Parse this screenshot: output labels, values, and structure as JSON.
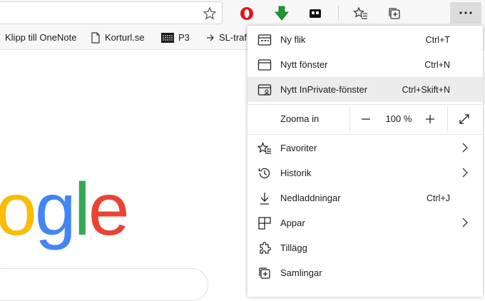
{
  "toolbar": {
    "icons": [
      "favorite-star-icon",
      "opera-icon",
      "download-arrow-icon",
      "extension-icon",
      "favorites-list-icon",
      "collections-icon",
      "more-icon"
    ],
    "colors": {
      "opera_red": "#e0161d",
      "download_green": "#1a9a2c"
    }
  },
  "bookmarks": {
    "items": [
      {
        "label": "Klipp till OneNote",
        "icon": "none"
      },
      {
        "label": "Korturl.se",
        "icon": "page-icon"
      },
      {
        "label": "P3",
        "icon": "sr-logo-icon"
      },
      {
        "label": "SL-traf",
        "icon": "arrow-right-icon"
      }
    ]
  },
  "google": {
    "logo_letters": [
      {
        "ch": "o",
        "color": "#fbbc05"
      },
      {
        "ch": "g",
        "color": "#4285f4"
      },
      {
        "ch": "l",
        "color": "#34a853"
      },
      {
        "ch": "e",
        "color": "#ea4335"
      }
    ]
  },
  "menu": {
    "items": [
      {
        "label": "Ny flik",
        "shortcut": "Ctrl+T",
        "icon": "new-tab-icon"
      },
      {
        "label": "Nytt fönster",
        "shortcut": "Ctrl+N",
        "icon": "new-window-icon"
      },
      {
        "label": "Nytt InPrivate-fönster",
        "shortcut": "Ctrl+Skift+N",
        "icon": "inprivate-icon"
      }
    ],
    "zoom": {
      "label": "Zooma in",
      "value": "100 %",
      "minus": "−",
      "plus": "+"
    },
    "items2": [
      {
        "label": "Favoriter",
        "shortcut": "",
        "icon": "favorites-icon",
        "submenu": true
      },
      {
        "label": "Historik",
        "shortcut": "",
        "icon": "history-icon",
        "submenu": true
      },
      {
        "label": "Nedladdningar",
        "shortcut": "Ctrl+J",
        "icon": "download-icon",
        "submenu": false
      },
      {
        "label": "Appar",
        "shortcut": "",
        "icon": "apps-icon",
        "submenu": true
      },
      {
        "label": "Tillägg",
        "shortcut": "",
        "icon": "extensions-icon",
        "submenu": false
      },
      {
        "label": "Samlingar",
        "shortcut": "",
        "icon": "collections-icon",
        "submenu": false
      }
    ]
  }
}
